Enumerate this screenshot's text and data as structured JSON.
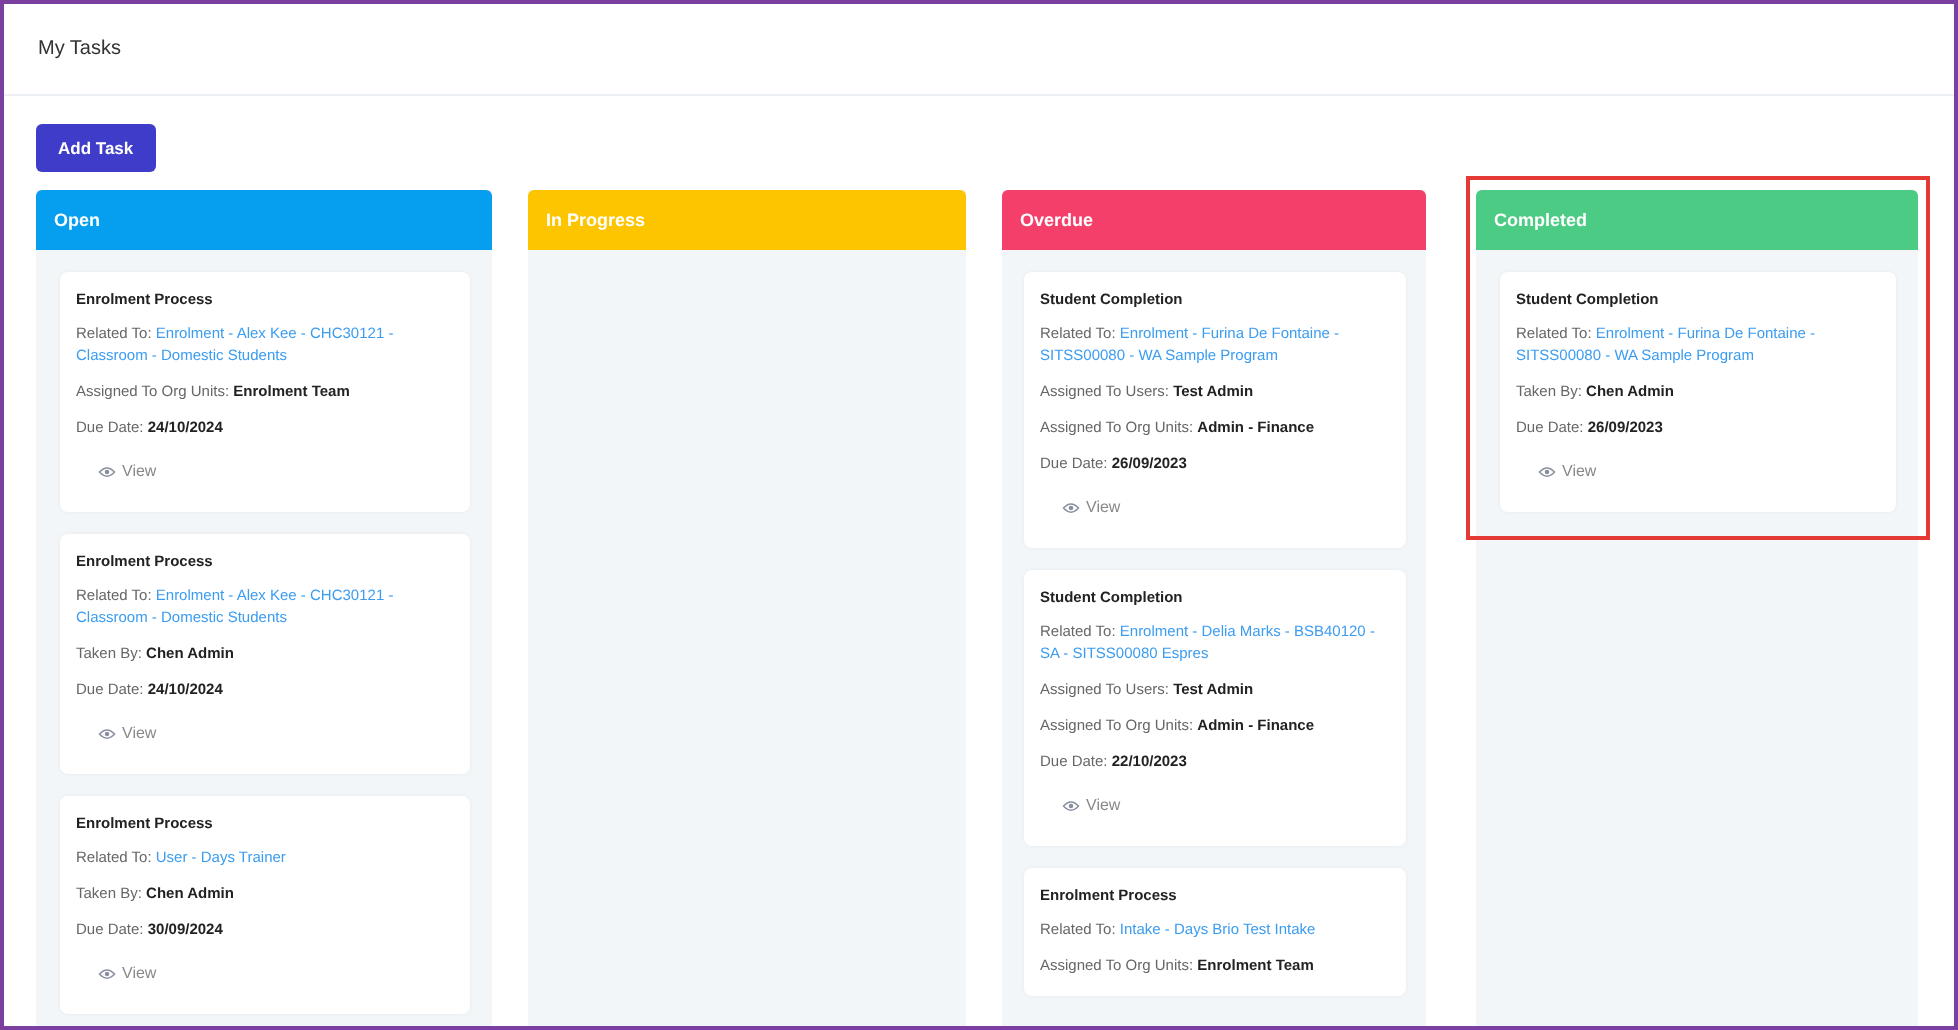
{
  "page": {
    "title": "My Tasks"
  },
  "add_button": {
    "label": "Add Task"
  },
  "columns": [
    {
      "title": "Open",
      "color": "#069ff0",
      "highlighted": false,
      "cards": [
        {
          "title": "Enrolment Process",
          "rows": [
            {
              "kind": "link",
              "label": "Related To:",
              "value": "Enrolment - Alex Kee - CHC30121 - Classroom - Domestic Students"
            },
            {
              "kind": "field",
              "label": "Assigned To Org Units:",
              "value": "Enrolment Team"
            },
            {
              "kind": "field",
              "label": "Due Date:",
              "value": "24/10/2024"
            }
          ],
          "action": "View"
        },
        {
          "title": "Enrolment Process",
          "rows": [
            {
              "kind": "link",
              "label": "Related To:",
              "value": "Enrolment - Alex Kee - CHC30121 - Classroom - Domestic Students"
            },
            {
              "kind": "field",
              "label": "Taken By:",
              "value": "Chen Admin"
            },
            {
              "kind": "field",
              "label": "Due Date:",
              "value": "24/10/2024"
            }
          ],
          "action": "View"
        },
        {
          "title": "Enrolment Process",
          "rows": [
            {
              "kind": "link",
              "label": "Related To:",
              "value": "User - Days Trainer"
            },
            {
              "kind": "field",
              "label": "Taken By:",
              "value": "Chen Admin"
            },
            {
              "kind": "field",
              "label": "Due Date:",
              "value": "30/09/2024"
            }
          ],
          "action": "View"
        }
      ]
    },
    {
      "title": "In Progress",
      "color": "#fdc500",
      "highlighted": false
    },
    {
      "title": "Overdue",
      "color": "#f43f6a",
      "highlighted": false,
      "cards": [
        {
          "title": "Student Completion",
          "rows": [
            {
              "kind": "link",
              "label": "Related To:",
              "value": "Enrolment - Furina De Fontaine - SITSS00080 - WA Sample Program"
            },
            {
              "kind": "field",
              "label": "Assigned To Users:",
              "value": "Test Admin"
            },
            {
              "kind": "field",
              "label": "Assigned To Org Units:",
              "value": "Admin - Finance"
            },
            {
              "kind": "field",
              "label": "Due Date:",
              "value": "26/09/2023"
            }
          ],
          "action": "View"
        },
        {
          "title": "Student Completion",
          "rows": [
            {
              "kind": "link",
              "label": "Related To:",
              "value": "Enrolment - Delia Marks - BSB40120 - SA - SITSS00080 Espres"
            },
            {
              "kind": "field",
              "label": "Assigned To Users:",
              "value": "Test Admin"
            },
            {
              "kind": "field",
              "label": "Assigned To Org Units:",
              "value": "Admin - Finance"
            },
            {
              "kind": "field",
              "label": "Due Date:",
              "value": "22/10/2023"
            }
          ],
          "action": "View"
        },
        {
          "title": "Enrolment Process",
          "rows": [
            {
              "kind": "link",
              "label": "Related To:",
              "value": "Intake - Days Brio Test Intake"
            },
            {
              "kind": "field",
              "label": "Assigned To Org Units:",
              "value": "Enrolment Team"
            }
          ]
        }
      ]
    },
    {
      "title": "Completed",
      "color": "#4ccb84",
      "highlighted": true,
      "cards": [
        {
          "title": "Student Completion",
          "rows": [
            {
              "kind": "link",
              "label": "Related To:",
              "value": "Enrolment - Furina De Fontaine - SITSS00080 - WA Sample Program"
            },
            {
              "kind": "field",
              "label": "Taken By:",
              "value": "Chen Admin"
            },
            {
              "kind": "field",
              "label": "Due Date:",
              "value": "26/09/2023"
            }
          ],
          "action": "View"
        }
      ]
    }
  ]
}
